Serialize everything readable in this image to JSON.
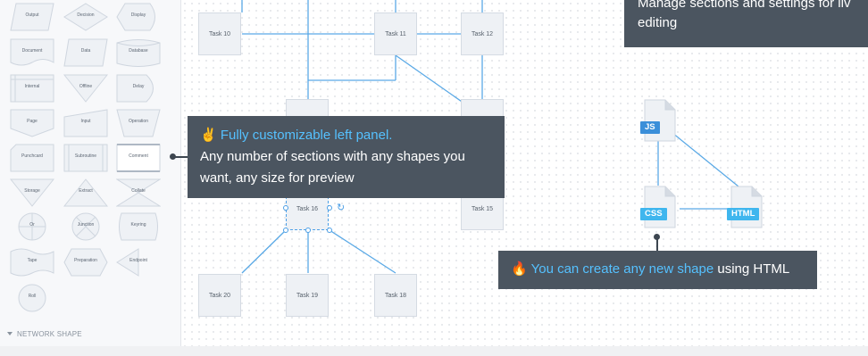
{
  "shapes": [
    {
      "label": "Output"
    },
    {
      "label": "Decision"
    },
    {
      "label": "Display"
    },
    {
      "label": "Document"
    },
    {
      "label": "Data"
    },
    {
      "label": "Database"
    },
    {
      "label": "Internal"
    },
    {
      "label": "Offline"
    },
    {
      "label": "Delay"
    },
    {
      "label": "Page"
    },
    {
      "label": "Input"
    },
    {
      "label": "Operation"
    },
    {
      "label": "Punchcard"
    },
    {
      "label": "Subroutine"
    },
    {
      "label": "Comment"
    },
    {
      "label": "Storage"
    },
    {
      "label": "Extract"
    },
    {
      "label": "Collate"
    },
    {
      "label": "Or"
    },
    {
      "label": "Junction"
    },
    {
      "label": "Keyring"
    },
    {
      "label": "Tape"
    },
    {
      "label": "Preparation"
    },
    {
      "label": "Endpoint"
    },
    {
      "label": "Roll"
    }
  ],
  "panel": {
    "section_label": "NETWORK SHAPE"
  },
  "tasks": {
    "t10": "Task 10",
    "t11": "Task 11",
    "t12": "Task 12",
    "t15": "Task 15",
    "t16": "Task 16",
    "t18": "Task 18",
    "t19": "Task 19",
    "t20": "Task 20"
  },
  "files": {
    "js": "JS",
    "css": "CSS",
    "html": "HTML"
  },
  "tooltips": {
    "left_panel": {
      "emoji": "✌",
      "title": "Fully customizable left panel.",
      "line1": "Any number of sections with any shapes you",
      "line2": "want, any size for preview"
    },
    "new_shape": {
      "emoji": "🔥",
      "highlight": "You can create any new shape",
      "rest": " using HTML"
    },
    "settings": {
      "line1": "Manage sections and settings for liv",
      "line2": "editing"
    }
  },
  "colors": {
    "accent": "#55c1ff",
    "tooltip_bg": "#4b5560",
    "connector": "#5aa9e6",
    "js_badge": "#3b8fd9",
    "css_badge": "#3fb6ee",
    "html_badge": "#3fb6ee"
  }
}
